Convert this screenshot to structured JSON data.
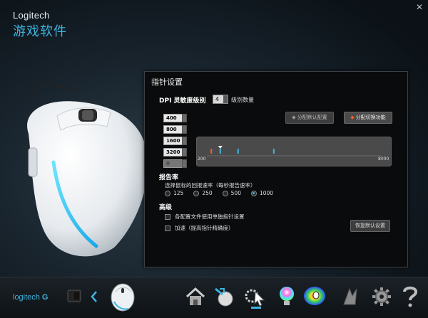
{
  "window": {
    "close_glyph": "✕"
  },
  "brand": {
    "company": "Logitech",
    "product": "游戏软件"
  },
  "panel": {
    "title": "指针设置",
    "dpi": {
      "label": "DPI 灵敏度级别",
      "level_count": "4",
      "level_count_label": "级别数量",
      "assign_default_label": "分配默认配置",
      "assign_switch_label": "分配切换功能",
      "levels": [
        "400",
        "800",
        "1600",
        "3200",
        "0"
      ],
      "slider_min": "200",
      "slider_max": "8000",
      "slider_range": [
        200,
        8000
      ],
      "markers": [
        {
          "value": 400,
          "color": "#f0602a"
        },
        {
          "value": 800,
          "color": "#3fb4e0"
        },
        {
          "value": 1600,
          "color": "#3fb4e0"
        },
        {
          "value": 3200,
          "color": "#3fb4e0"
        }
      ]
    },
    "report_rate": {
      "title": "报告率",
      "description": "选择鼠标的回报速率（每秒报告速率）",
      "options": [
        "125",
        "250",
        "500",
        "1000"
      ],
      "selected": "1000"
    },
    "advanced": {
      "title": "高级",
      "per_profile_label": "各配置文件使用单独指针设置",
      "acceleration_label": "加速（提高指针精确度）",
      "restore_label": "恢复默认设置"
    }
  },
  "bottom_bar": {
    "logo_text": "logitech",
    "logo_g": "G",
    "accent": "#3fb4e0"
  }
}
